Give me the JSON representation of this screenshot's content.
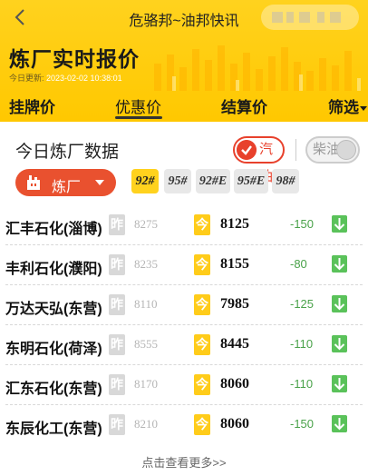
{
  "nav": {
    "title": "危骆邦~油邦快讯"
  },
  "header": {
    "title": "炼厂实时报价",
    "update_label": "今日更新: ",
    "update_time": "2023-02-02 10:38:01"
  },
  "tabs": [
    {
      "label": "挂牌价",
      "active": false
    },
    {
      "label": "优惠价",
      "active": true
    },
    {
      "label": "结算价",
      "active": false
    },
    {
      "label": "筛选",
      "active": false
    }
  ],
  "section": {
    "title": "今日炼厂数据"
  },
  "fuel": {
    "gasoline": "汽油",
    "diesel": "柴油",
    "selected": "gasoline"
  },
  "filter": {
    "refinery_label": "炼厂"
  },
  "grades": [
    {
      "label": "92#",
      "selected": true
    },
    {
      "label": "95#",
      "selected": false
    },
    {
      "label": "92#E",
      "selected": false
    },
    {
      "label": "95#E",
      "selected": false
    },
    {
      "label": "98#",
      "selected": false
    }
  ],
  "badges": {
    "yesterday": "昨",
    "today": "今"
  },
  "rows": [
    {
      "name": "汇丰石化(淄博)",
      "yesterday": "8275",
      "today": "8125",
      "change": "-150"
    },
    {
      "name": "丰利石化(濮阳)",
      "yesterday": "8235",
      "today": "8155",
      "change": "-80"
    },
    {
      "name": "万达天弘(东营)",
      "yesterday": "8110",
      "today": "7985",
      "change": "-125"
    },
    {
      "name": "东明石化(荷泽)",
      "yesterday": "8555",
      "today": "8445",
      "change": "-110"
    },
    {
      "name": "汇东石化(东营)",
      "yesterday": "8170",
      "today": "8060",
      "change": "-110"
    },
    {
      "name": "东辰化工(东营)",
      "yesterday": "8210",
      "today": "8060",
      "change": "-150"
    }
  ],
  "footer": {
    "more": "点击查看更多>>"
  },
  "colors": {
    "header_yellow": "#ffd21e",
    "accent_red": "#e9512f",
    "down_green": "#5ac25a"
  }
}
